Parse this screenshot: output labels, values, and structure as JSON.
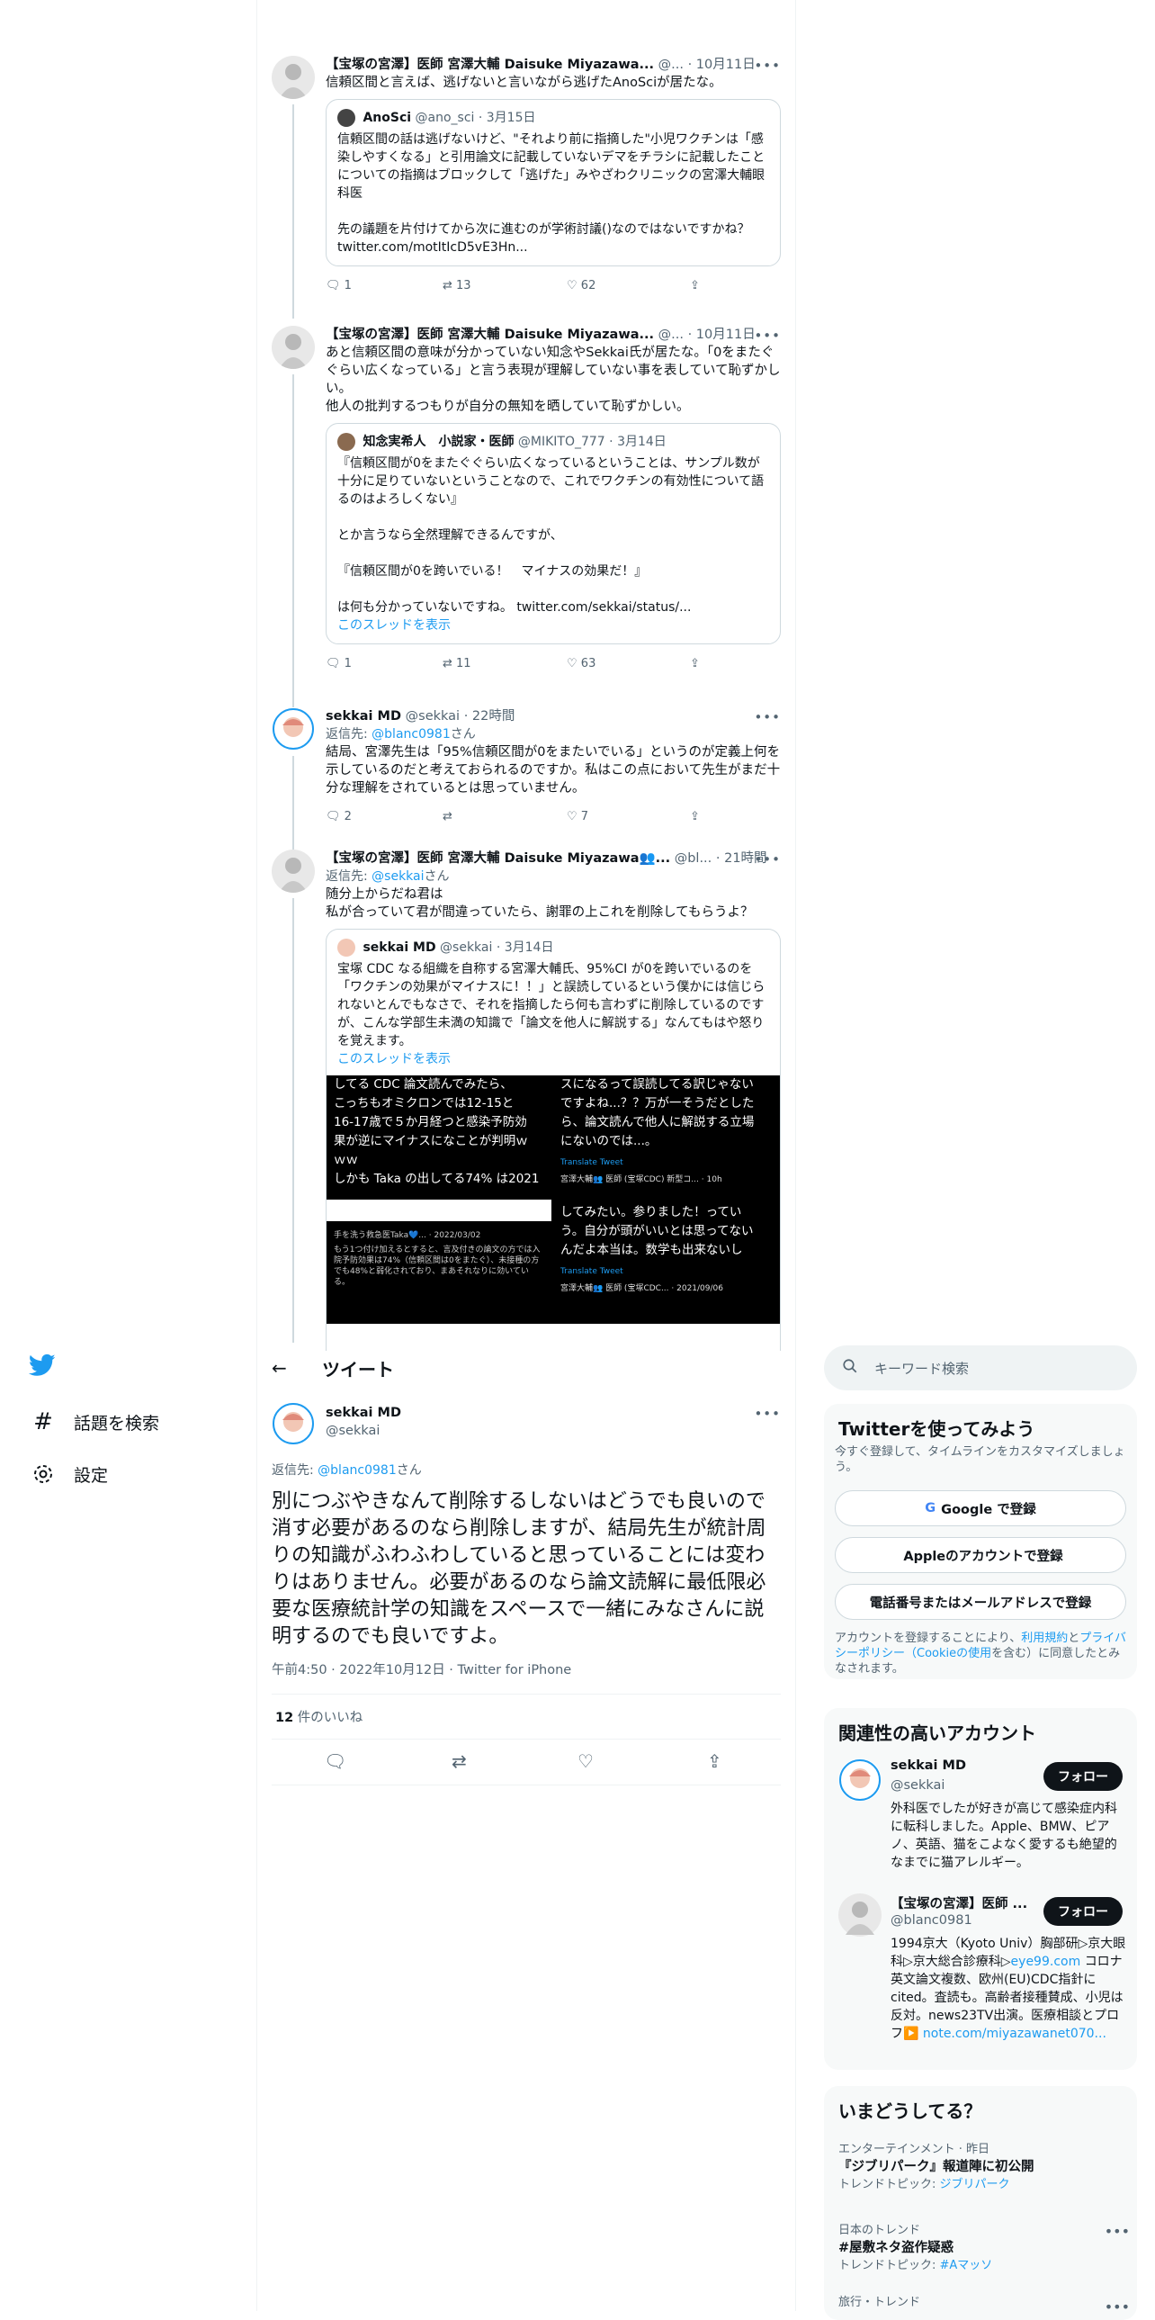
{
  "thread": [
    {
      "name": "【宝塚の宮澤】医師 宮澤大輔 Daisuke Miyazawa...",
      "handle": "@...",
      "time": "· 10月11日",
      "text": "信頼区間と言えば、逃げないと言いながら逃げたAnoSciが居たな。",
      "quote": {
        "name": "AnoSci",
        "handle": "@ano_sci",
        "time": "· 3月15日",
        "text": "信頼区間の話は逃げないけど、\"それより前に指摘した\"小児ワクチンは「感染しやすくなる」と引用論文に記載していないデマをチラシに記載したことについての指摘はブロックして「逃げた」みやざわクリニックの宮澤大輔眼科医\n\n先の議題を片付けてから次に進むのが学術討議()なのではないですかね？ twitter.com/motItIcD5vE3Hn..."
      },
      "replies": "1",
      "retweets": "13",
      "likes": "62"
    },
    {
      "name": "【宝塚の宮澤】医師 宮澤大輔 Daisuke Miyazawa...",
      "handle": "@...",
      "time": "· 10月11日",
      "text": "あと信頼区間の意味が分かっていない知念やSekkai氏が居たな。「0をまたぐぐらい広くなっている」と言う表現が理解していない事を表していて恥ずかしい。\n他人の批判するつもりが自分の無知を晒していて恥ずかしい。",
      "quote": {
        "name": "知念実希人　小説家・医師",
        "handle": "@MIKITO_777",
        "time": "· 3月14日",
        "text": "『信頼区間が0をまたぐぐらい広くなっているということは、サンプル数が十分に足りていないということなので、これでワクチンの有効性について語るのはよろしくない』\n\nとか言うなら全然理解できるんですが、\n\n『信頼区間が0を跨いでいる！　マイナスの効果だ！』\n\nは何も分かっていないですね。 twitter.com/sekkai/status/...",
        "show_thread": "このスレッドを表示"
      },
      "replies": "1",
      "retweets": "11",
      "likes": "63"
    },
    {
      "name": "sekkai MD",
      "handle": "@sekkai",
      "time": "· 22時間",
      "reply_to_prefix": "返信先: ",
      "reply_to": "@blanc0981",
      "reply_to_suffix": "さん",
      "text": "結局、宮澤先生は「95%信頼区間が0をまたいでいる」というのが定義上何を示しているのだと考えておられるのですか。私はこの点において先生がまだ十分な理解をされているとは思っていません。",
      "replies": "2",
      "retweets": "",
      "likes": "7"
    },
    {
      "name": "【宝塚の宮澤】医師 宮澤大輔 Daisuke Miyazawa👥...",
      "handle": "@bl...",
      "time": "· 21時間",
      "reply_to_prefix": "返信先: ",
      "reply_to": "@sekkai",
      "reply_to_suffix": "さん",
      "text": "随分上からだね君は\n私が合っていて君が間違っていたら、謝罪の上これを削除してもらうよ？",
      "quote": {
        "name": "sekkai MD",
        "handle": "@sekkai",
        "time": "· 3月14日",
        "text": "宝塚 CDC なる組織を自称する宮澤大輔氏、95%CI が0を跨いでいるのを「ワクチンの効果がマイナスに！！」と誤読しているという僕かには信じられないとんでもなさで、それを指摘したら何も言わずに削除しているのですが、こんな学部生未満の知識で「論文を他人に解説する」なんてもはや怒りを覚えます。",
        "show_thread": "このスレッドを表示",
        "images": [
          {
            "text": "してる CDC 論文読んでみたら、\nこっちもオミクロンでは12-15と\n16-17歳で５か月経つと感染予防効\n果が逆にマイナスになことが判明ｗ\nｗｗ\nしかも Taka の出してる74% は2021"
          },
          {
            "text": "スになるって誤読してる訳じゃない\nですよね...？？万が一そうだとした\nら、論文読んで他人に解説する立場\nにないのでは...。",
            "translate": "Translate Tweet",
            "author": "宮澤大輔👥 医師 (宝塚CDC) 新型コ...",
            "time": "10h"
          },
          {
            "author": "手を洗う救急医Taka💙...",
            "time": "2022/03/02",
            "text": "もう1つ付け加えるとすると、言及付きの論文の方では入院予防効果は74%（信頼区間は0をまたぐ）、未接種の方でも48%と弱化されており、まあそれなりに効いている。"
          },
          {
            "text": "してみたい。参りました！ってい\nう。自分が頭がいいとは思ってない\nんだよ本当は。数学も出来ないし",
            "translate": "Translate Tweet",
            "author": "宮澤大輔👥 医師 (宝塚CDC...",
            "time": "2021/09/06"
          }
        ]
      }
    }
  ],
  "nav": {
    "explore": "話題を検索",
    "settings": "設定"
  },
  "main": {
    "header": "ツイート",
    "name": "sekkai MD",
    "handle": "@sekkai",
    "reply_to_prefix": "返信先: ",
    "reply_to": "@blanc0981",
    "reply_to_suffix": "さん",
    "text": "別につぶやきなんて削除するしないはどうでも良いので消す必要があるのなら削除しますが、結局先生が統計周りの知識がふわふわしていると思っていることには変わりはありません。必要があるのなら論文読解に最低限必要な医療統計学の知識をスペースで一緒にみなさんに説明するのでも良いですよ。",
    "time": "午前4:50 · 2022年10月12日",
    "source": "Twitter for iPhone",
    "likes_count": "12",
    "likes_label": "件のいいね"
  },
  "right": {
    "search_placeholder": "キーワード検索",
    "signup": {
      "title": "Twitterを使ってみよう",
      "desc": "今すぐ登録して、タイムラインをカスタマイズしましょう。",
      "google": "Google で登録",
      "apple": "Appleのアカウントで登録",
      "phone": "電話番号またはメールアドレスで登録",
      "terms_1": "アカウントを登録することにより、",
      "terms_link1": "利用規約",
      "terms_2": "と",
      "terms_link2": "プライバシーポリシー（Cookieの使用",
      "terms_3": "を含む）に同意したとみなされます。"
    },
    "related": {
      "title": "関連性の高いアカウント",
      "accounts": [
        {
          "name": "sekkai MD",
          "handle": "@sekkai",
          "follow": "フォロー",
          "bio": "外科医でしたが好きが高じて感染症内科に転科しました。Apple、BMW、ピアノ、英語、猫をこよなく愛するも絶望的なまでに猫アレルギー。"
        },
        {
          "name": "【宝塚の宮澤】医師 ...",
          "handle": "@blanc0981",
          "follow": "フォロー",
          "bio": "1994京大（Kyoto Univ）胸部研▷京大眼科▷京大総合診療科▷",
          "bio_link": "eye99.com",
          "bio2": "コロナ英文論文複数、欧州(EU)CDC指針にcited。査読も。高齢者接種賛成、小児は反対。news23TV出演。医療相談とプロフ▶️",
          "bio_link2": "note.com/miyazawanet070..."
        }
      ]
    },
    "trends": {
      "title": "いまどうしてる？",
      "items": [
        {
          "context": "エンターテインメント · 昨日",
          "title": "『ジブリパーク』報道陣に初公開",
          "topic_prefix": "トレンドトピック: ",
          "topic": "ジブリパーク"
        },
        {
          "context": "日本のトレンド",
          "title": "#屋敷ネタ盗作疑惑",
          "topic_prefix": "トレンドトピック: ",
          "topic": "#Aマッソ"
        },
        {
          "context": "旅行・トレンド",
          "title": ""
        }
      ]
    }
  }
}
